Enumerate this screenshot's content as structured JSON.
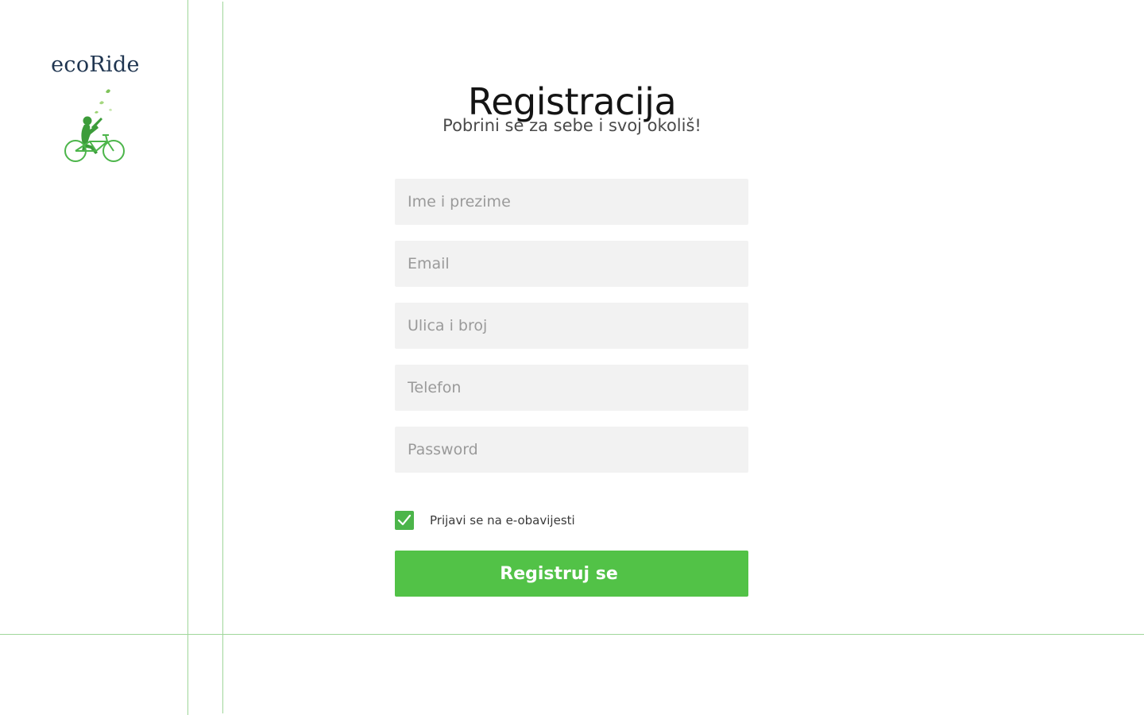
{
  "brand": {
    "name": "ecoRide",
    "logo_icon": "cyclist-icon",
    "accent_color": "#52c247"
  },
  "header": {
    "title": "Registracija",
    "subtitle": "Pobrini se za sebe i svoj okoliš!"
  },
  "form": {
    "fields": [
      {
        "name": "full-name",
        "placeholder": "Ime i prezime",
        "value": ""
      },
      {
        "name": "email",
        "placeholder": "Email",
        "value": ""
      },
      {
        "name": "street",
        "placeholder": "Ulica i broj",
        "value": ""
      },
      {
        "name": "phone",
        "placeholder": "Telefon",
        "value": ""
      },
      {
        "name": "password",
        "placeholder": "Password",
        "value": ""
      }
    ],
    "newsletter": {
      "label": "Prijavi se na e-obavijesti",
      "checked": true,
      "icon": "checkmark-icon"
    },
    "submit_label": "Registruj se"
  }
}
